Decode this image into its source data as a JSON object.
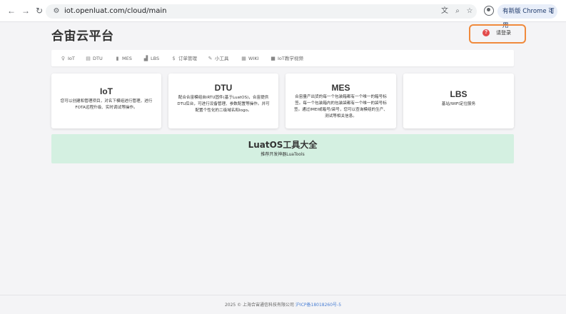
{
  "browser": {
    "back_glyph": "←",
    "forward_glyph": "→",
    "reload_glyph": "↻",
    "url": "iot.openluat.com/cloud/main",
    "update_label": "有新版 Chrome 可用",
    "menu_glyph": "⋮",
    "icons": [
      "translate-icon",
      "zoom-icon",
      "bookmark-star-icon",
      "profile-icon"
    ]
  },
  "header": {
    "brand": "合宙云平台",
    "login_label": "请登录",
    "login_icon_glyph": "?",
    "accent_color": "#f08a3c"
  },
  "menu": {
    "items": [
      {
        "icon": "♀",
        "label": "IoT",
        "icon_name": "iot-icon"
      },
      {
        "icon": "▤",
        "label": "DTU",
        "icon_name": "dtu-icon"
      },
      {
        "icon": "▮",
        "label": "MES",
        "icon_name": "mes-icon"
      },
      {
        "icon": "▟",
        "label": "LBS",
        "icon_name": "lbs-icon"
      },
      {
        "icon": "$",
        "label": "订单管理",
        "icon_name": "dollar-icon"
      },
      {
        "icon": "✎",
        "label": "小工具",
        "icon_name": "wrench-icon"
      },
      {
        "icon": "▦",
        "label": "WIKI",
        "icon_name": "wiki-icon"
      },
      {
        "icon": "■",
        "label": "IoT教学视频",
        "icon_name": "video-icon"
      }
    ]
  },
  "cards": [
    {
      "title": "IoT",
      "desc": "您可以创建和管理项目，对名下模组进行管理，进行FOTA远程升级、实时调试等操作。"
    },
    {
      "title": "DTU",
      "desc": "配合合宙模组自iRTU固件(基于LuatOS)，合宙提供DTU后台，可进行设备管理、参数配置等操作。并可配置个性化的二级域名和logo。"
    },
    {
      "title": "MES",
      "desc": "合宙量产出货的每一个包装箱都有一个唯一的箱号标签。每一个包装箱内的包装袋都有一个唯一的袋号标签。通过IMEI或箱号/袋号，您可以查询模组的生产、测试等相关信息。"
    },
    {
      "title": "LBS",
      "desc": "基站/WIFI定位服务"
    }
  ],
  "banner": {
    "title": "LuatOS工具大全",
    "subtitle": "推荐开发神器LuaTools",
    "bg_color": "#d4f0e1"
  },
  "footer": {
    "copyright": "2025 © 上海合宙通信科技有限公司 ",
    "icp": "沪ICP备18018260号-5"
  }
}
